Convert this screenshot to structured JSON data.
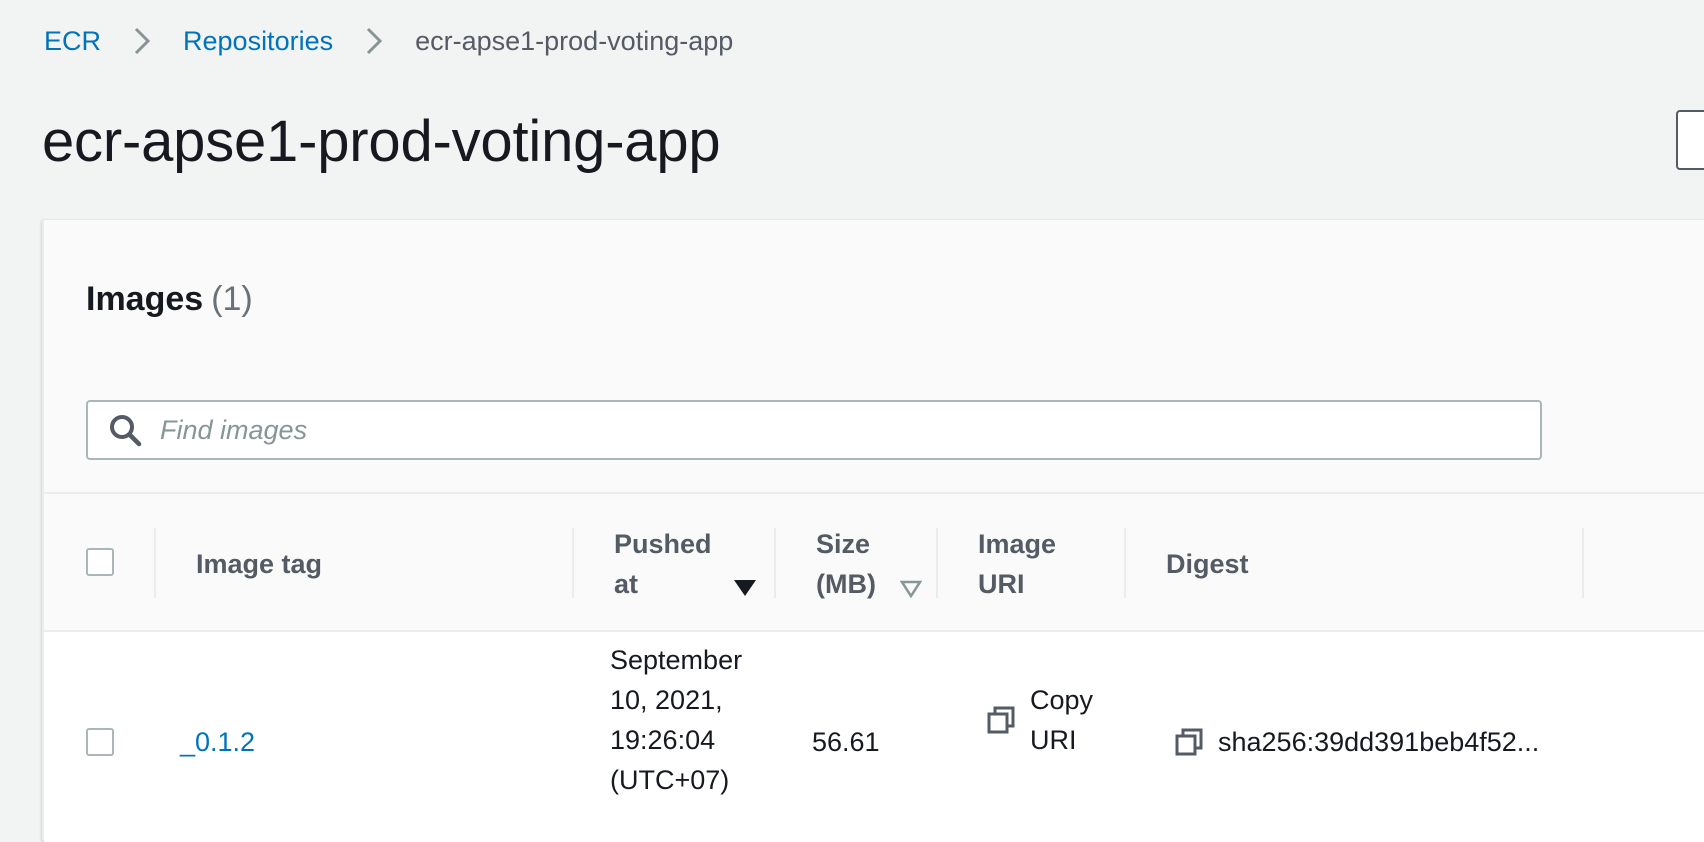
{
  "breadcrumb": {
    "items": [
      "ECR",
      "Repositories",
      "ecr-apse1-prod-voting-app"
    ]
  },
  "page": {
    "title": "ecr-apse1-prod-voting-app"
  },
  "images_panel": {
    "title": "Images",
    "count": "(1)",
    "search_placeholder": "Find images",
    "search_value": "",
    "columns": {
      "image_tag": "Image tag",
      "pushed_at_line1": "Pushed",
      "pushed_at_line2": "at",
      "size_line1": "Size",
      "size_line2": "(MB)",
      "image_uri_line1": "Image",
      "image_uri_line2": "URI",
      "digest": "Digest"
    },
    "sort": {
      "active_column": "Pushed at",
      "direction": "descending"
    },
    "rows": [
      {
        "image_tag": "_0.1.2",
        "pushed_at_line1": "September",
        "pushed_at_line2": "10, 2021,",
        "pushed_at_line3": "19:26:04",
        "pushed_at_line4": "(UTC+07)",
        "size": "56.61",
        "uri_line1": "Copy",
        "uri_line2": "URI",
        "digest": "sha256:39dd391beb4f52..."
      }
    ]
  },
  "colors": {
    "link": "#0073bb",
    "background": "#f2f3f3",
    "text": "#16191f",
    "muted": "#545b64"
  },
  "icons": {
    "breadcrumb_separator": "chevron-right-icon",
    "search": "search-icon",
    "sort_active": "caret-down-filled-icon",
    "sort_inactive": "caret-down-outline-icon",
    "copy": "copy-icon"
  }
}
